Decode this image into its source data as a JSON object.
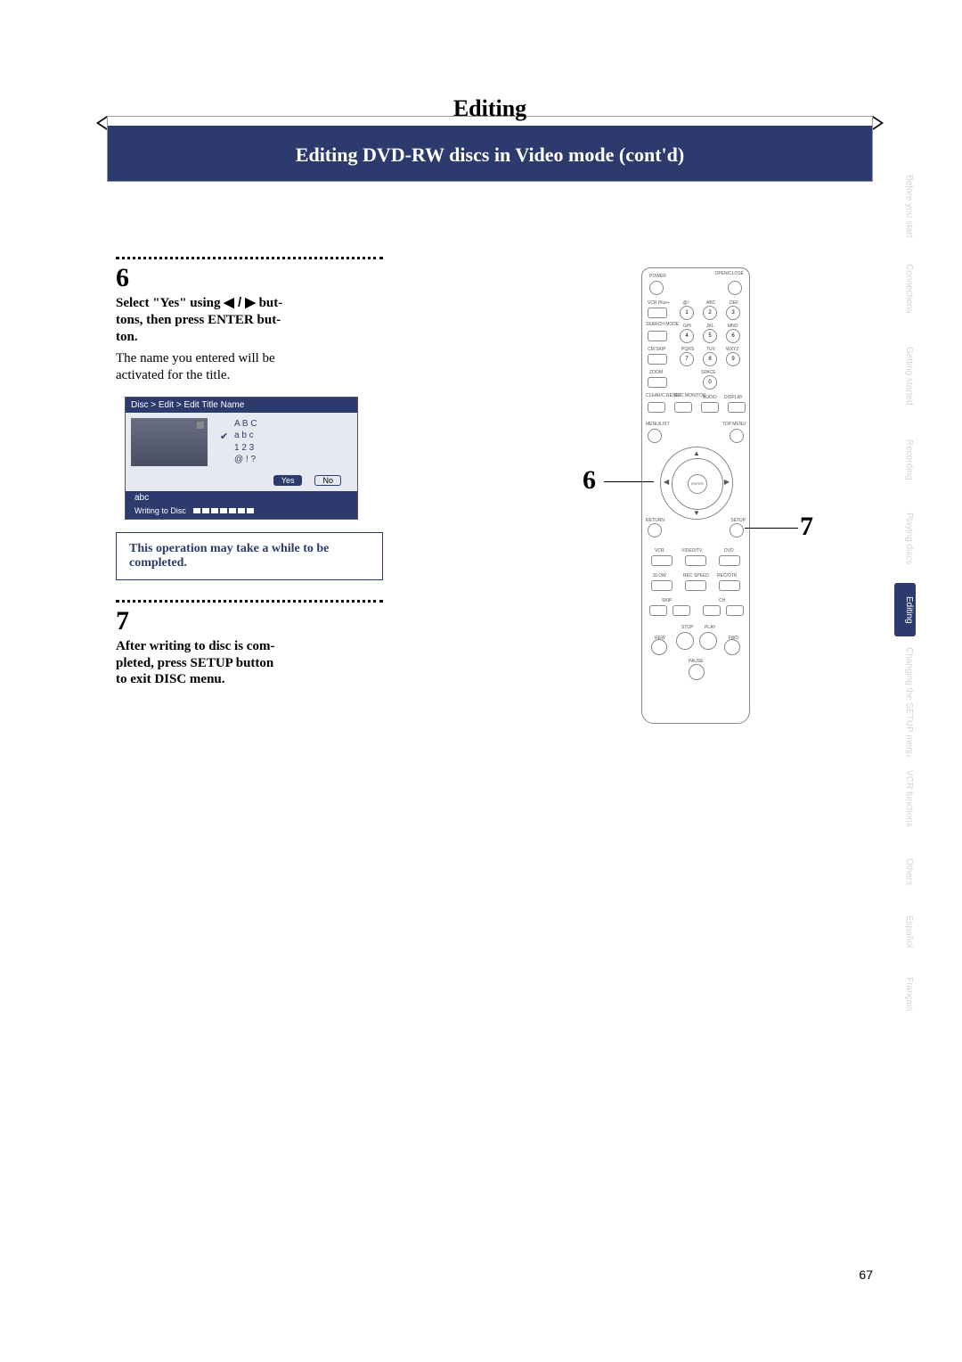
{
  "title": "Editing",
  "subtitle": "Editing DVD-RW discs in Video mode (cont'd)",
  "side_tabs": [
    "Before you start",
    "Connections",
    "Getting started",
    "Recording",
    "Playing discs",
    "Editing",
    "Changing the SETUP menu",
    "VCR functions",
    "Others",
    "Español",
    "Français"
  ],
  "step6": {
    "num": "6",
    "line1a": "Select \"Yes\" using ",
    "arrows": "◀ / ▶",
    "line1b": " but-",
    "line2": "tons, then press ENTER but-",
    "line3": "ton.",
    "body1": "The name you entered will be",
    "body2": "activated for the title."
  },
  "osd": {
    "breadcrumb": "Disc > Edit > Edit Title Name",
    "opt_upper": "A B C",
    "opt_lower": "a b c",
    "opt_num": "1 2 3",
    "opt_sym": "@ ! ?",
    "yes": "Yes",
    "no": "No",
    "entered": "abc",
    "writing": "Writing to Disc"
  },
  "note": "This operation may take a while to be completed.",
  "step7": {
    "num": "7",
    "line1": "After writing to disc is com-",
    "line2": "pleted, press SETUP button",
    "line3": "to exit DISC menu."
  },
  "remote": {
    "power": "POWER",
    "open_close": "OPEN/CLOSE",
    "vcrplus": "VCR Plus+",
    "dot_at": ".@/:",
    "abc": "ABC",
    "def": "DEF",
    "search_mode": "SEARCH MODE",
    "ghi": "GHI",
    "jkl": "JKL",
    "mno": "MNO",
    "cm_skip": "CM SKIP",
    "pqrs": "PQRS",
    "tuv": "TUV",
    "wxyz": "WXYZ",
    "zoom": "ZOOM",
    "space": "SPACE",
    "clear_creset": "CLEAR/C.RESET",
    "rec_monitor": "REC MONITOR",
    "audio": "AUDIO",
    "display": "DISPLAY",
    "menu_list": "MENU/LIST",
    "top_menu": "TOP MENU",
    "enter": "ENTER",
    "return": "RETURN",
    "setup": "SETUP",
    "vcr": "VCR",
    "video_tv": "VIDEO/TV",
    "dvd": "DVD",
    "slow": "SLOW",
    "rec_speed": "REC SPEED",
    "rec_otr": "REC/OTR",
    "skip": "SKIP",
    "ch": "CH",
    "stop": "STOP",
    "play": "PLAY",
    "rew": "REW",
    "fwd": "FWD",
    "pause": "PAUSE",
    "keys": [
      "1",
      "2",
      "3",
      "4",
      "5",
      "6",
      "7",
      "8",
      "9",
      "0"
    ]
  },
  "callouts": {
    "six": "6",
    "seven": "7"
  },
  "page_number": "67"
}
